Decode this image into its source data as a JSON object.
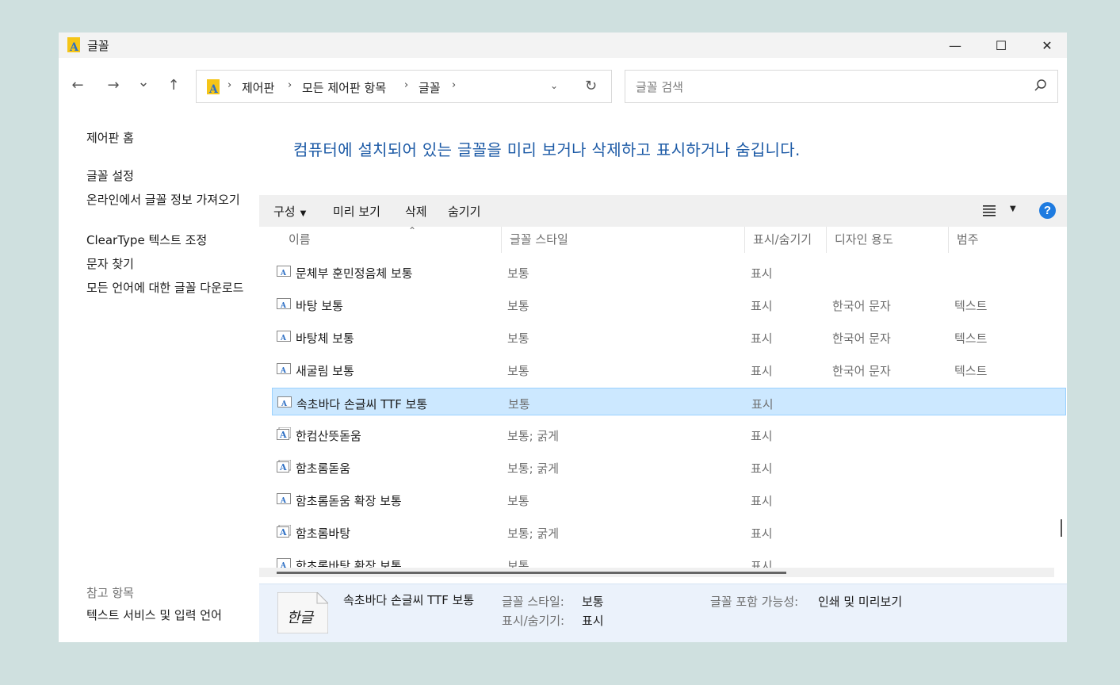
{
  "window": {
    "title": "글꼴"
  },
  "title_buttons": {
    "minimize": "—",
    "maximize": "☐",
    "close": "✕"
  },
  "nav": {
    "back": "←",
    "forward": "→",
    "recent": "⌄",
    "up": "↑"
  },
  "address": {
    "crumbs": [
      "제어판",
      "모든 제어판 항목",
      "글꼴"
    ],
    "separator": "›"
  },
  "search": {
    "placeholder": "글꼴 검색"
  },
  "left_pane": {
    "home": "제어판 홈",
    "links": [
      "글꼴 설정",
      "온라인에서 글꼴 정보 가져오기",
      "ClearType 텍스트 조정",
      "문자 찾기",
      "모든 언어에 대한 글꼴 다운로드"
    ],
    "see_also_heading": "참고 항목",
    "see_also_links": [
      "텍스트 서비스 및 입력 언어"
    ]
  },
  "main": {
    "heading": "컴퓨터에 설치되어 있는 글꼴을 미리 보거나 삭제하고 표시하거나 숨깁니다."
  },
  "commandbar": {
    "organize": "구성",
    "preview": "미리 보기",
    "delete": "삭제",
    "hide": "숨기기",
    "help": "?"
  },
  "columns": [
    "이름",
    "글꼴 스타일",
    "표시/숨기기",
    "디자인 용도",
    "범주"
  ],
  "fonts": [
    {
      "name": "문체부 훈민정음체 보통",
      "style": "보통",
      "show": "표시",
      "design": "",
      "category": "",
      "family": false
    },
    {
      "name": "바탕 보통",
      "style": "보통",
      "show": "표시",
      "design": "한국어 문자",
      "category": "텍스트",
      "family": false
    },
    {
      "name": "바탕체 보통",
      "style": "보통",
      "show": "표시",
      "design": "한국어 문자",
      "category": "텍스트",
      "family": false
    },
    {
      "name": "새굴림 보통",
      "style": "보통",
      "show": "표시",
      "design": "한국어 문자",
      "category": "텍스트",
      "family": false
    },
    {
      "name": "속초바다 손글씨 TTF 보통",
      "style": "보통",
      "show": "표시",
      "design": "",
      "category": "",
      "family": false,
      "selected": true
    },
    {
      "name": "한컴산뜻돋움",
      "style": "보통; 굵게",
      "show": "표시",
      "design": "",
      "category": "",
      "family": true
    },
    {
      "name": "함초롬돋움",
      "style": "보통; 굵게",
      "show": "표시",
      "design": "",
      "category": "",
      "family": true
    },
    {
      "name": "함초롬돋움 확장 보통",
      "style": "보통",
      "show": "표시",
      "design": "",
      "category": "",
      "family": false
    },
    {
      "name": "함초롬바탕",
      "style": "보통; 굵게",
      "show": "표시",
      "design": "",
      "category": "",
      "family": true
    },
    {
      "name": "함초롬바탕 확장 보통",
      "style": "보통",
      "show": "표시",
      "design": "",
      "category": "",
      "family": false
    }
  ],
  "details": {
    "name": "속초바다 손글씨 TTF 보통",
    "preview_text": "한글",
    "style_label": "글꼴 스타일:",
    "style_value": "보통",
    "show_label": "표시/숨기기:",
    "show_value": "표시",
    "embed_label": "글꼴 포함 가능성:",
    "embed_value": "인쇄 및 미리보기"
  },
  "colors": {
    "accent": "#1c5aa6",
    "selection": "#cce8ff",
    "selection_border": "#99d1ff",
    "help": "#1e7be0",
    "icon_gold": "#f5c518",
    "icon_blue": "#2d6fc4"
  }
}
